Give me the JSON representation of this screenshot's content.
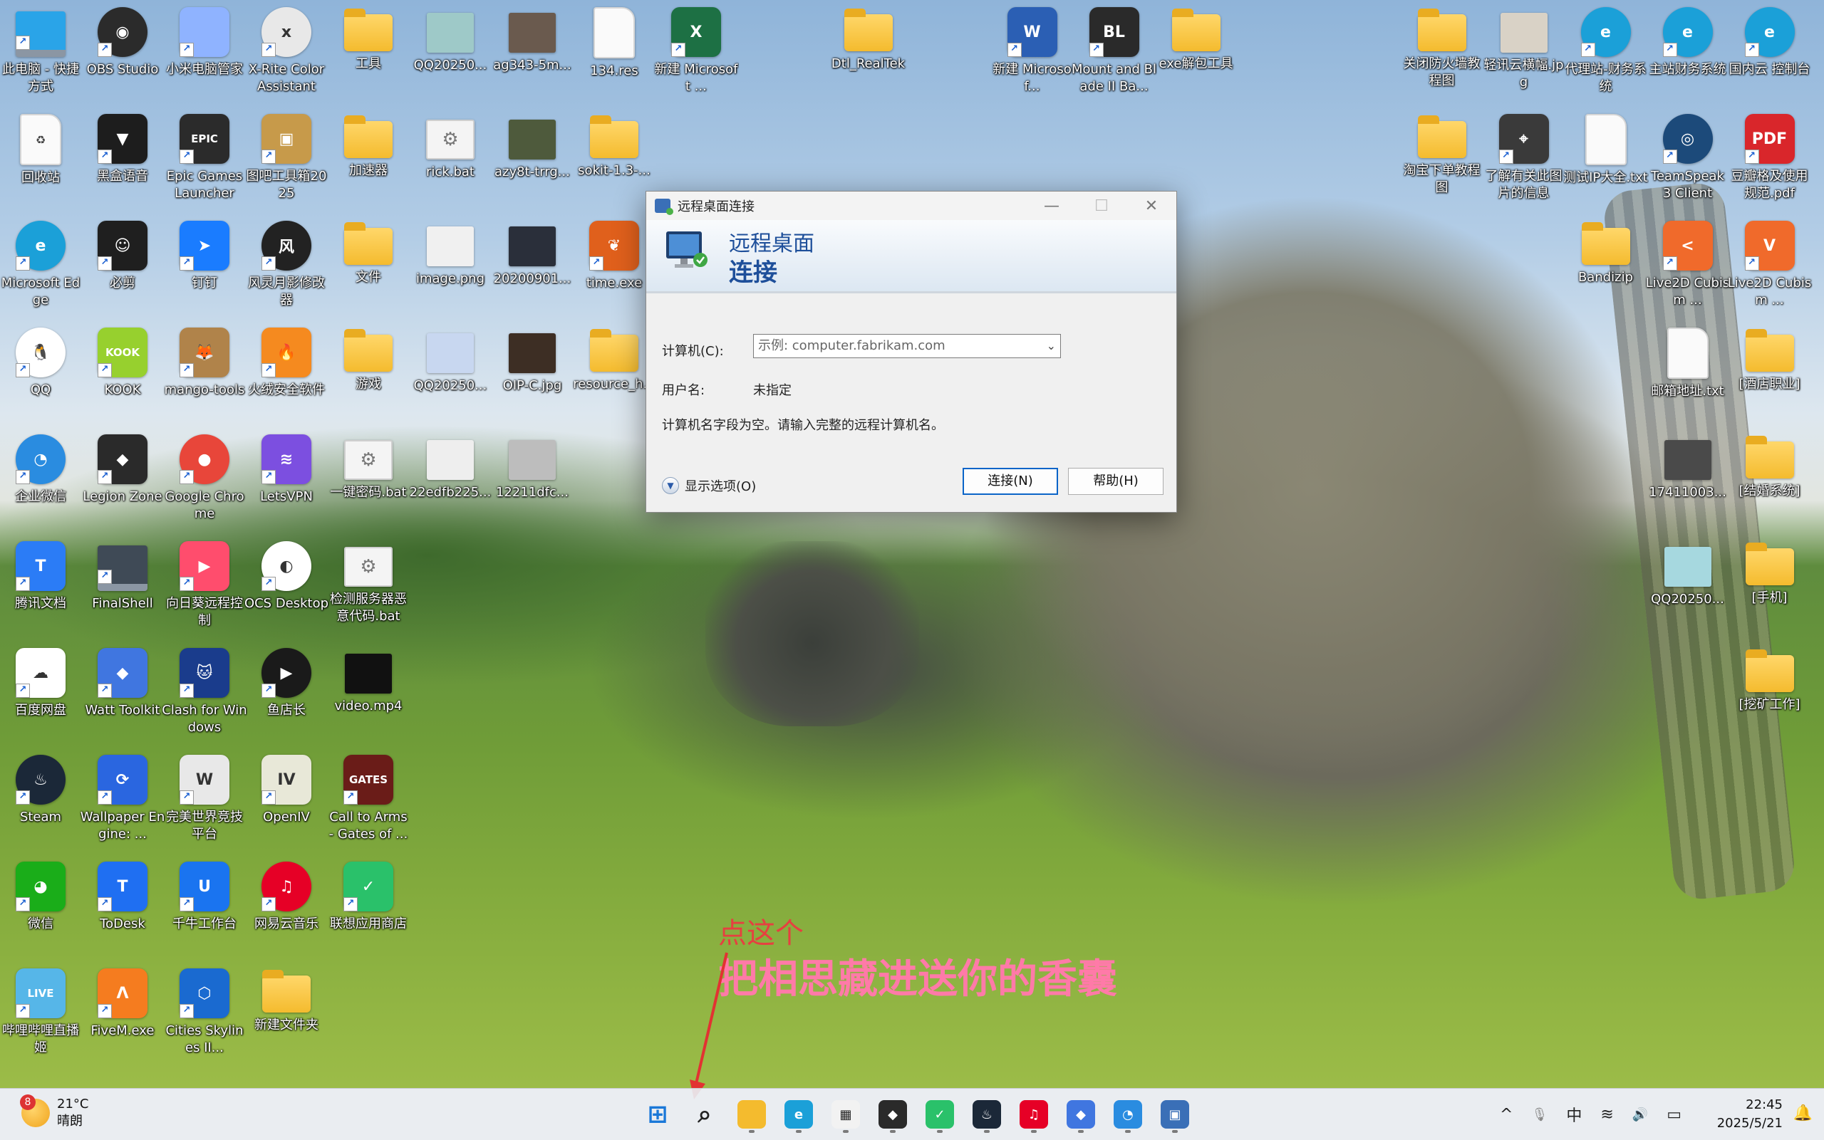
{
  "desktop": {
    "icons": [
      {
        "label": "此电脑 - 快捷方式",
        "kind": "monitor",
        "color": "#2aa4e8"
      },
      {
        "label": "OBS Studio",
        "kind": "circle",
        "color": "#2b2b2b",
        "text": "◉"
      },
      {
        "label": "小米电脑管家",
        "kind": "app",
        "color": "#8fb3ff",
        "text": ""
      },
      {
        "label": "X-Rite Color Assistant",
        "kind": "circle",
        "color": "#e8e8e8",
        "text": "x"
      },
      {
        "label": "工具",
        "kind": "folder",
        "color": "#f4bb2e"
      },
      {
        "label": "QQ20250...",
        "kind": "img",
        "color": "#9ec9c8"
      },
      {
        "label": "ag343-5m...",
        "kind": "img",
        "color": "#6a5a4e"
      },
      {
        "label": "134.res",
        "kind": "doc",
        "color": "#fafafa"
      },
      {
        "label": "新建 Microsoft ...",
        "kind": "app",
        "color": "#1d7044",
        "text": "X"
      },
      {
        "label": "Dtl_RealTek",
        "kind": "folder",
        "color": "#f4bb2e"
      },
      {
        "label": "新建 Microsof...",
        "kind": "app",
        "color": "#2b5fb4",
        "text": "W"
      },
      {
        "label": "Mount and Blade II Ba...",
        "kind": "app",
        "color": "#2a2a2a",
        "text": "BL"
      },
      {
        "label": "exe解包工具",
        "kind": "folder",
        "color": "#f4bb2e"
      },
      {
        "label": "关闭防火墙教程图",
        "kind": "folder",
        "color": "#f4bb2e"
      },
      {
        "label": "轻讯云横幅.jpg",
        "kind": "img",
        "color": "#d9d2c6"
      },
      {
        "label": "代理站-财务系统",
        "kind": "circle",
        "color": "#1ba0d8",
        "text": "e"
      },
      {
        "label": "主站财务系统",
        "kind": "circle",
        "color": "#1ba0d8",
        "text": "e"
      },
      {
        "label": "国内云 控制台",
        "kind": "circle",
        "color": "#1ba0d8",
        "text": "e"
      },
      {
        "label": "回收站",
        "kind": "doc",
        "color": "#fafafa",
        "text": "♻"
      },
      {
        "label": "黑盒语音",
        "kind": "app",
        "color": "#1d1d1d",
        "text": "▼"
      },
      {
        "label": "Epic Games Launcher",
        "kind": "app",
        "color": "#2b2b2b",
        "text": "EPIC"
      },
      {
        "label": "图吧工具箱2025",
        "kind": "app",
        "color": "#c79a4a",
        "text": "▣"
      },
      {
        "label": "加速器",
        "kind": "folder",
        "color": "#f4bb2e"
      },
      {
        "label": "rick.bat",
        "kind": "bat",
        "color": "#f4f4f4",
        "text": "⚙"
      },
      {
        "label": "azy8t-trrg...",
        "kind": "img",
        "color": "#4e5a3c"
      },
      {
        "label": "sokit-1.3-...",
        "kind": "folder",
        "color": "#f4bb2e"
      },
      {
        "label": "淘宝下单教程图",
        "kind": "folder",
        "color": "#f4bb2e"
      },
      {
        "label": "了解有关此图片的信息",
        "kind": "app",
        "color": "#3a3a3a",
        "text": "⌖"
      },
      {
        "label": "测试IP大全.txt",
        "kind": "doc",
        "color": "#fafafa"
      },
      {
        "label": "TeamSpeak 3 Client",
        "kind": "circle",
        "color": "#1c4a7a",
        "text": "◎"
      },
      {
        "label": "豆瓣格及使用规范.pdf",
        "kind": "app",
        "color": "#d9262b",
        "text": "PDF"
      },
      {
        "label": "Microsoft Edge",
        "kind": "circle",
        "color": "#1ba0d8",
        "text": "e"
      },
      {
        "label": "必剪",
        "kind": "app",
        "color": "#1f1f1f",
        "text": "☺"
      },
      {
        "label": "钉钉",
        "kind": "app",
        "color": "#1a7cff",
        "text": "➤"
      },
      {
        "label": "风灵月影修改器",
        "kind": "circle",
        "color": "#222",
        "text": "风"
      },
      {
        "label": "文件",
        "kind": "folder",
        "color": "#f4bb2e"
      },
      {
        "label": "image.png",
        "kind": "img",
        "color": "#f0f0f0"
      },
      {
        "label": "20200901...",
        "kind": "img",
        "color": "#2a2f3a"
      },
      {
        "label": "time.exe",
        "kind": "app",
        "color": "#e0601c",
        "text": "❦"
      },
      {
        "label": "Bandizip",
        "kind": "folder",
        "color": "#f4bb2e"
      },
      {
        "label": "Live2D Cubism ...",
        "kind": "app",
        "color": "#f06a2b",
        "text": "<"
      },
      {
        "label": "Live2D Cubism ...",
        "kind": "app",
        "color": "#f06a2b",
        "text": "V"
      },
      {
        "label": "QQ",
        "kind": "circle",
        "color": "#ffffff",
        "text": "🐧"
      },
      {
        "label": "KOOK",
        "kind": "app",
        "color": "#97d02e",
        "text": "KOOK"
      },
      {
        "label": "mango-tools",
        "kind": "app",
        "color": "#b0834a",
        "text": "🦊"
      },
      {
        "label": "火绒安全软件",
        "kind": "app",
        "color": "#f58a1f",
        "text": "🔥"
      },
      {
        "label": "游戏",
        "kind": "folder",
        "color": "#f4bb2e"
      },
      {
        "label": "QQ20250...",
        "kind": "img",
        "color": "#c8d7f0"
      },
      {
        "label": "OIP-C.jpg",
        "kind": "img",
        "color": "#3d2e24"
      },
      {
        "label": "resource_h...",
        "kind": "folder",
        "color": "#f4bb2e"
      },
      {
        "label": "邮箱地址.txt",
        "kind": "doc",
        "color": "#fafafa"
      },
      {
        "label": "[酒店职业]",
        "kind": "folder",
        "color": "#f4bb2e"
      },
      {
        "label": "企业微信",
        "kind": "circle",
        "color": "#2a8ce0",
        "text": "◔"
      },
      {
        "label": "Legion Zone",
        "kind": "app",
        "color": "#2a2a2a",
        "text": "◆"
      },
      {
        "label": "Google Chrome",
        "kind": "circle",
        "color": "#e8463a",
        "text": "●"
      },
      {
        "label": "LetsVPN",
        "kind": "app",
        "color": "#7c4fe0",
        "text": "≋"
      },
      {
        "label": "一键密码.bat",
        "kind": "bat",
        "color": "#f4f4f4",
        "text": "⚙"
      },
      {
        "label": "22edfb225...",
        "kind": "img",
        "color": "#eeeeee"
      },
      {
        "label": "12211dfc...",
        "kind": "img",
        "color": "#bdbdbd"
      },
      {
        "label": "17411003...",
        "kind": "img",
        "color": "#4a4a4a"
      },
      {
        "label": "[结婚系统]",
        "kind": "folder",
        "color": "#f4bb2e"
      },
      {
        "label": "腾讯文档",
        "kind": "app",
        "color": "#2b7cf6",
        "text": "T"
      },
      {
        "label": "FinalShell",
        "kind": "monitor",
        "color": "#3f4a56"
      },
      {
        "label": "向日葵远程控制",
        "kind": "app",
        "color": "#ff4d6d",
        "text": "▶"
      },
      {
        "label": "OCS Desktop",
        "kind": "circle",
        "color": "#ffffff",
        "text": "◐"
      },
      {
        "label": "检测服务器恶意代码.bat",
        "kind": "bat",
        "color": "#f4f4f4",
        "text": "⚙"
      },
      {
        "label": "QQ20250...",
        "kind": "img",
        "color": "#a6d8df"
      },
      {
        "label": "[手机]",
        "kind": "folder",
        "color": "#f4bb2e"
      },
      {
        "label": "百度网盘",
        "kind": "app",
        "color": "#ffffff",
        "text": "☁"
      },
      {
        "label": "Watt Toolkit",
        "kind": "app",
        "color": "#4076e0",
        "text": "◆"
      },
      {
        "label": "Clash for Windows",
        "kind": "app",
        "color": "#1a3c8c",
        "text": "🐱"
      },
      {
        "label": "鱼店长",
        "kind": "circle",
        "color": "#1a1a1a",
        "text": "▶"
      },
      {
        "label": "video.mp4",
        "kind": "img",
        "color": "#111111"
      },
      {
        "label": "[挖矿工作]",
        "kind": "folder",
        "color": "#f4bb2e"
      },
      {
        "label": "Steam",
        "kind": "circle",
        "color": "#1b2838",
        "text": "♨"
      },
      {
        "label": "Wallpaper Engine: ...",
        "kind": "app",
        "color": "#2a66e0",
        "text": "⟳"
      },
      {
        "label": "完美世界竞技平台",
        "kind": "app",
        "color": "#e8e8e8",
        "text": "W"
      },
      {
        "label": "OpenIV",
        "kind": "app",
        "color": "#e8e8d8",
        "text": "IV"
      },
      {
        "label": "Call to Arms - Gates of ...",
        "kind": "app",
        "color": "#6a1c18",
        "text": "GATES"
      },
      {
        "label": "微信",
        "kind": "app",
        "color": "#1aad19",
        "text": "◕"
      },
      {
        "label": "ToDesk",
        "kind": "app",
        "color": "#1f6ff2",
        "text": "T"
      },
      {
        "label": "千牛工作台",
        "kind": "app",
        "color": "#1a74f0",
        "text": "U"
      },
      {
        "label": "网易云音乐",
        "kind": "circle",
        "color": "#e60026",
        "text": "♫"
      },
      {
        "label": "联想应用商店",
        "kind": "app",
        "color": "#2ac16a",
        "text": "✓"
      },
      {
        "label": "哔哩哔哩直播姬",
        "kind": "app",
        "color": "#56b6e8",
        "text": "LIVE"
      },
      {
        "label": "FiveM.exe",
        "kind": "app",
        "color": "#f57c1f",
        "text": "Λ"
      },
      {
        "label": "Cities Skylines II...",
        "kind": "app",
        "color": "#1a6ad0",
        "text": "⬡"
      },
      {
        "label": "新建文件夹",
        "kind": "folder",
        "color": "#f4bb2e"
      }
    ]
  },
  "dialog": {
    "window_title": "远程桌面连接",
    "banner_line1": "远程桌面",
    "banner_line2": "连接",
    "computer_label": "计算机(C):",
    "computer_placeholder": "示例: computer.fabrikam.com",
    "username_label": "用户名:",
    "username_value": "未指定",
    "hint": "计算机名字段为空。请输入完整的远程计算机名。",
    "show_options": "显示选项(O)",
    "connect_button": "连接(N)",
    "help_button": "帮助(H)"
  },
  "annotation": {
    "line1": "点这个",
    "line2": "把相思藏进送你的香囊"
  },
  "taskbar": {
    "weather_badge": "8",
    "temperature": "21°C",
    "condition": "晴朗",
    "apps": [
      {
        "name": "start-icon",
        "color": "#1a78d8",
        "text": "⊞"
      },
      {
        "name": "search-icon",
        "color": "transparent",
        "text": "⌕"
      },
      {
        "name": "file-explorer-icon",
        "color": "#f4bb2e",
        "text": ""
      },
      {
        "name": "edge-icon",
        "color": "#1ba0d8",
        "text": "e"
      },
      {
        "name": "store-icon",
        "color": "#f2f2f2",
        "text": "▦"
      },
      {
        "name": "legion-icon",
        "color": "#2a2a2a",
        "text": "◆"
      },
      {
        "name": "store-green-icon",
        "color": "#2ac16a",
        "text": "✓"
      },
      {
        "name": "steam-icon",
        "color": "#1b2838",
        "text": "♨"
      },
      {
        "name": "netease-music-icon",
        "color": "#e60026",
        "text": "♫"
      },
      {
        "name": "watt-toolkit-icon",
        "color": "#4076e0",
        "text": "◆"
      },
      {
        "name": "wecom-icon",
        "color": "#2a8ce0",
        "text": "◔"
      },
      {
        "name": "remote-desktop-icon",
        "color": "#3a6fb7",
        "text": "▣"
      }
    ],
    "tray_chevron": "^",
    "tray_mic": "🎙",
    "ime": "中",
    "tray_wifi": "≋",
    "tray_volume": "🔊",
    "tray_battery": "▭",
    "time": "22:45",
    "date": "2025/5/21",
    "bell": "🔔"
  }
}
